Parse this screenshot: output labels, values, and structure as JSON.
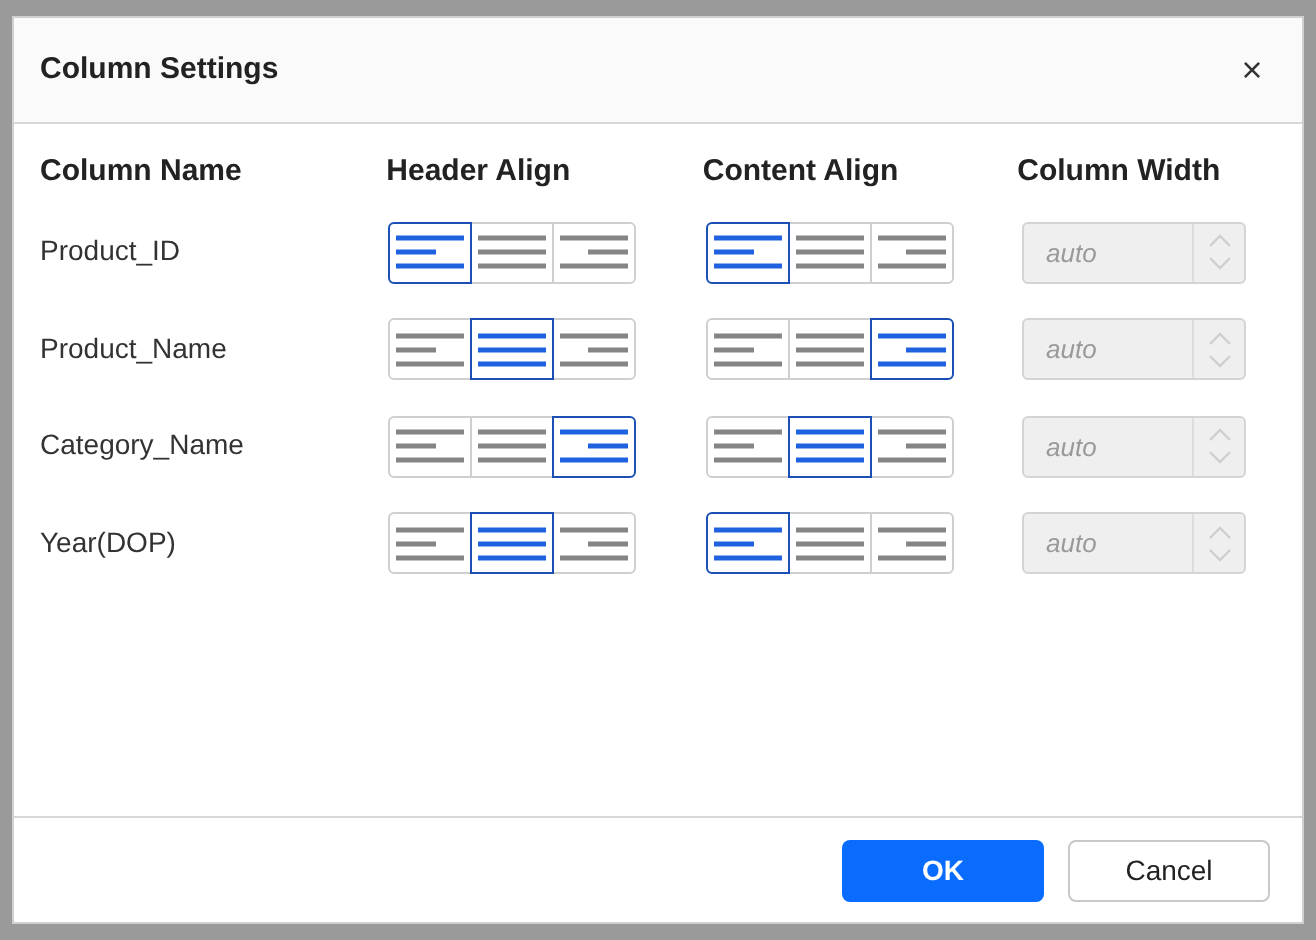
{
  "dialog": {
    "title": "Column Settings",
    "close": "×"
  },
  "columns": [
    "Column Name",
    "Header Align",
    "Content Align",
    "Column Width"
  ],
  "rows": [
    {
      "name": "Product_ID",
      "header_align": [
        {
          "kind": "left",
          "selected": true
        },
        {
          "kind": "center",
          "selected": false
        },
        {
          "kind": "right",
          "selected": false
        }
      ],
      "content_align": [
        {
          "kind": "left",
          "selected": true
        },
        {
          "kind": "center",
          "selected": false
        },
        {
          "kind": "right",
          "selected": false
        }
      ],
      "width": {
        "value": "auto",
        "disabled": true
      }
    },
    {
      "name": "Product_Name",
      "header_align": [
        {
          "kind": "left",
          "selected": false
        },
        {
          "kind": "center",
          "selected": true
        },
        {
          "kind": "right",
          "selected": false
        }
      ],
      "content_align": [
        {
          "kind": "left",
          "selected": false
        },
        {
          "kind": "center",
          "selected": false
        },
        {
          "kind": "right",
          "selected": true
        }
      ],
      "width": {
        "value": "auto",
        "disabled": true
      }
    },
    {
      "name": "Category_Name",
      "header_align": [
        {
          "kind": "left",
          "selected": false
        },
        {
          "kind": "center",
          "selected": false
        },
        {
          "kind": "right",
          "selected": true
        }
      ],
      "content_align": [
        {
          "kind": "left",
          "selected": false
        },
        {
          "kind": "center",
          "selected": true
        },
        {
          "kind": "right",
          "selected": false
        }
      ],
      "width": {
        "value": "auto",
        "disabled": true
      }
    },
    {
      "name": "Year(DOP)",
      "header_align": [
        {
          "kind": "left",
          "selected": false
        },
        {
          "kind": "center",
          "selected": true
        },
        {
          "kind": "right",
          "selected": false
        }
      ],
      "content_align": [
        {
          "kind": "left",
          "selected": true
        },
        {
          "kind": "center",
          "selected": false
        },
        {
          "kind": "right",
          "selected": false
        }
      ],
      "width": {
        "value": "auto",
        "disabled": true
      }
    }
  ],
  "buttons": [
    {
      "label": "OK",
      "kind": "primary"
    },
    {
      "label": "Cancel",
      "kind": "secondary"
    }
  ]
}
